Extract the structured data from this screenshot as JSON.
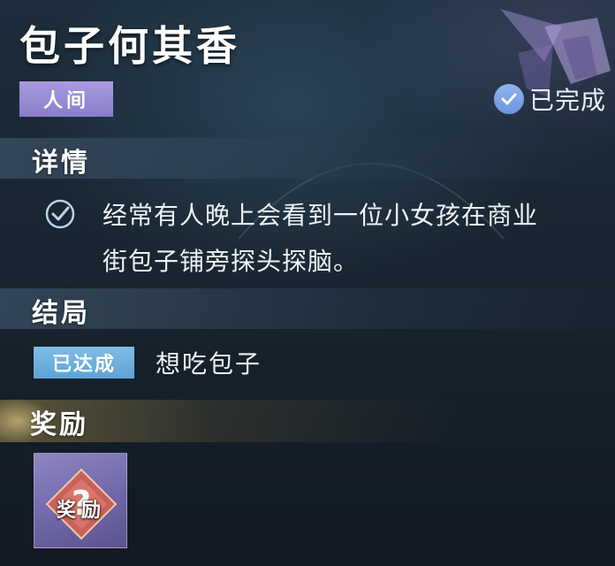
{
  "quest": {
    "title": "包子何其香",
    "type_badge": "人间",
    "status_text": "已完成"
  },
  "details": {
    "heading": "详情",
    "lines": [
      "经常有人晚上会看到一位小女孩在商业",
      "街包子铺旁探头探脑。"
    ]
  },
  "ending": {
    "heading": "结局",
    "badge": "已达成",
    "text": "想吃包子"
  },
  "reward": {
    "heading": "奖励",
    "item_label": "奖励"
  },
  "icons": {
    "status": "check-circle-icon",
    "detail": "check-icon",
    "corner": "crystal-emblem-icon",
    "reward": "mystery-reward-icon"
  },
  "colors": {
    "badge_purple": "#9d90d8",
    "badge_blue": "#6fb1de",
    "reward_bg": "#7a72b4"
  }
}
